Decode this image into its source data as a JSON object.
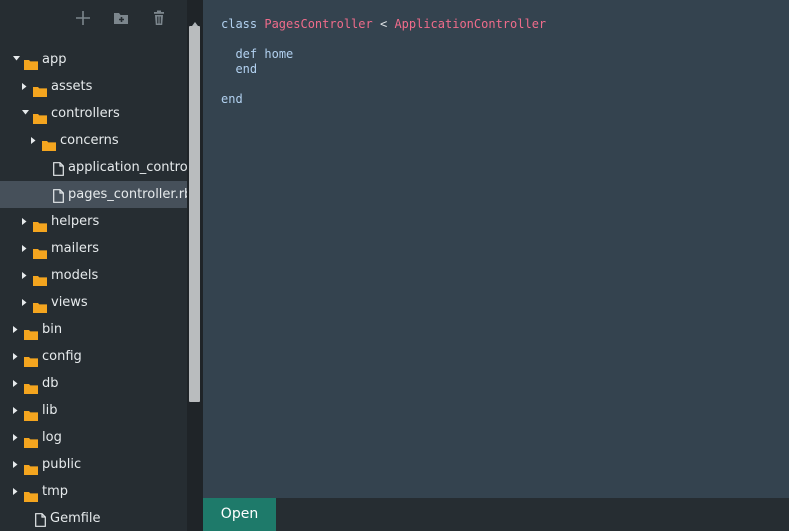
{
  "sidebar": {
    "toolbar": {
      "add_icon": "plus-icon",
      "folder_icon": "new-folder-icon",
      "delete_icon": "trash-icon"
    },
    "tree": [
      {
        "label": "app",
        "type": "folder",
        "expanded": true
      },
      {
        "label": "assets",
        "type": "folder",
        "expanded": false
      },
      {
        "label": "controllers",
        "type": "folder",
        "expanded": true
      },
      {
        "label": "concerns",
        "type": "folder",
        "expanded": false
      },
      {
        "label": "application_controller.rb",
        "type": "file"
      },
      {
        "label": "pages_controller.rb",
        "type": "file",
        "selected": true
      },
      {
        "label": "helpers",
        "type": "folder",
        "expanded": false
      },
      {
        "label": "mailers",
        "type": "folder",
        "expanded": false
      },
      {
        "label": "models",
        "type": "folder",
        "expanded": false
      },
      {
        "label": "views",
        "type": "folder",
        "expanded": false
      },
      {
        "label": "bin",
        "type": "folder",
        "expanded": false
      },
      {
        "label": "config",
        "type": "folder",
        "expanded": false
      },
      {
        "label": "db",
        "type": "folder",
        "expanded": false
      },
      {
        "label": "lib",
        "type": "folder",
        "expanded": false
      },
      {
        "label": "log",
        "type": "folder",
        "expanded": false
      },
      {
        "label": "public",
        "type": "folder",
        "expanded": false
      },
      {
        "label": "tmp",
        "type": "folder",
        "expanded": false
      },
      {
        "label": "Gemfile",
        "type": "file"
      }
    ]
  },
  "editor": {
    "code": {
      "line1": {
        "kw": "class",
        "name": "PagesController",
        "op": "<",
        "parent": "ApplicationController"
      },
      "line2": {
        "kw": "def",
        "name": "home"
      },
      "line3": {
        "kw": "end"
      },
      "line4": {
        "kw": "end"
      }
    }
  },
  "bottombar": {
    "open_label": "Open"
  },
  "colors": {
    "folder": "#f4a51f",
    "selected_row": "#46505a",
    "editor_bg": "#34434f",
    "keyword": "#b2d1f0",
    "class_name": "#ef6c8b",
    "open_button": "#1e7a6a"
  }
}
